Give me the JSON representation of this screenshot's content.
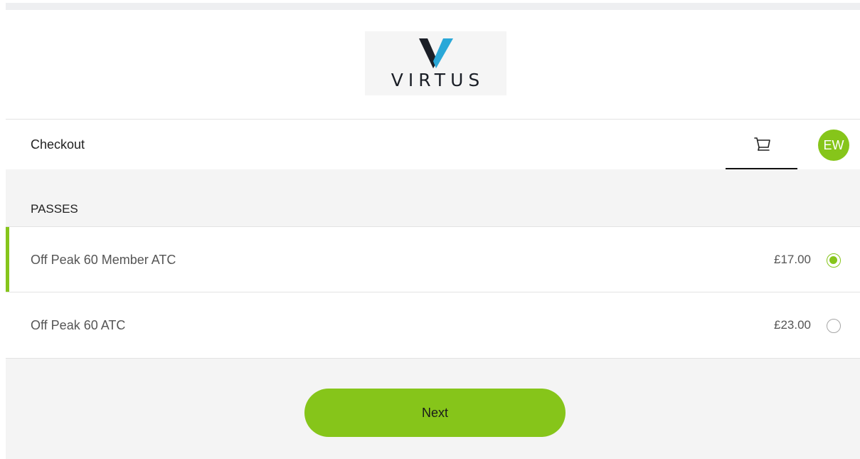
{
  "brand": {
    "logo_text": "VIRTUS",
    "accent_color": "#86c51a"
  },
  "header": {
    "title": "Checkout",
    "cart_icon": "cart-icon",
    "avatar_initials": "EW"
  },
  "passes": {
    "section_title": "PASSES",
    "items": [
      {
        "name": "Off Peak 60 Member ATC",
        "price": "£17.00",
        "selected": true
      },
      {
        "name": "Off Peak 60 ATC",
        "price": "£23.00",
        "selected": false
      }
    ]
  },
  "actions": {
    "next_label": "Next"
  }
}
